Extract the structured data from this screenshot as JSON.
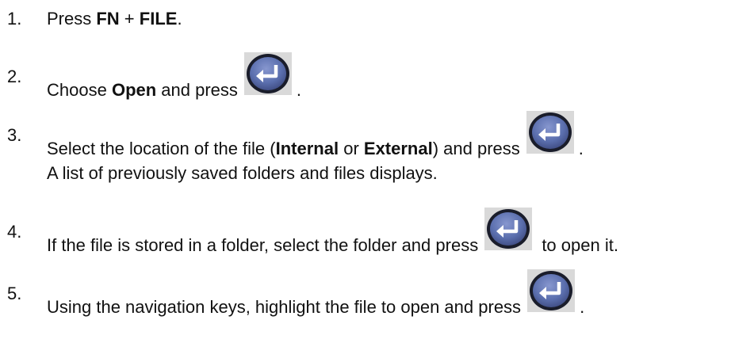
{
  "steps": [
    {
      "number": "1.",
      "parts": [
        {
          "t": "Press "
        },
        {
          "t": "FN",
          "b": true
        },
        {
          "t": " + "
        },
        {
          "t": "FILE",
          "b": true
        },
        {
          "t": "."
        }
      ]
    },
    {
      "number": "2.",
      "parts": [
        {
          "t": "Choose "
        },
        {
          "t": "Open",
          "b": true
        },
        {
          "t": " and press"
        },
        {
          "icon": "enter-key-icon"
        },
        {
          "t": "."
        }
      ]
    },
    {
      "number": "3.",
      "parts": [
        {
          "t": "Select the location of the file ("
        },
        {
          "t": "Internal",
          "b": true
        },
        {
          "t": " or "
        },
        {
          "t": "External",
          "b": true
        },
        {
          "t": ") and press"
        },
        {
          "icon": "enter-key-icon"
        },
        {
          "t": "."
        }
      ]
    },
    {
      "number": "",
      "parts": [
        {
          "t": "A list of previously saved folders and files displays."
        }
      ]
    },
    {
      "number": "4.",
      "parts": [
        {
          "t": "If the file is stored in a folder, select the folder and press"
        },
        {
          "icon": "enter-key-icon"
        },
        {
          "t": " to open it."
        }
      ]
    },
    {
      "number": "5.",
      "parts": [
        {
          "t": "Using the navigation keys, highlight the file to open and press"
        },
        {
          "icon": "enter-key-icon"
        },
        {
          "t": "."
        }
      ]
    }
  ],
  "colors": {
    "key_fill": "#5b6fae",
    "key_ring": "#1a1d2b",
    "key_arrow": "#ffffff"
  }
}
